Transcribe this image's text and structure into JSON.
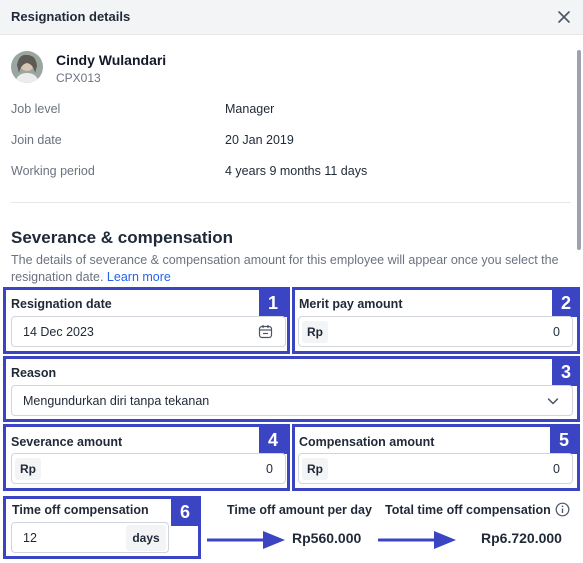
{
  "header": {
    "title": "Resignation details"
  },
  "employee": {
    "name": "Cindy Wulandari",
    "code": "CPX013"
  },
  "info": [
    {
      "label": "Job level",
      "value": "Manager"
    },
    {
      "label": "Join date",
      "value": "20 Jan 2019"
    },
    {
      "label": "Working period",
      "value": "4 years 9 months 11 days"
    }
  ],
  "section": {
    "title": "Severance & compensation",
    "description": "The details of severance & compensation amount for this employee will appear once you select the resignation date.",
    "learn_more": "Learn more"
  },
  "annotations": [
    "1",
    "2",
    "3",
    "4",
    "5",
    "6"
  ],
  "fields": {
    "resignation_date": {
      "label": "Resignation date",
      "value": "14 Dec 2023"
    },
    "merit_pay": {
      "label": "Merit pay amount",
      "prefix": "Rp",
      "value": "0"
    },
    "reason": {
      "label": "Reason",
      "value": "Mengundurkan diri tanpa tekanan"
    },
    "severance": {
      "label": "Severance amount",
      "prefix": "Rp",
      "value": "0"
    },
    "compensation": {
      "label": "Compensation amount",
      "prefix": "Rp",
      "value": "0"
    },
    "time_off": {
      "label": "Time off compensation",
      "value": "12",
      "suffix": "days"
    }
  },
  "calc": {
    "per_day_label": "Time off amount per day",
    "per_day_value": "Rp560.000",
    "total_label": "Total time off compensation",
    "total_value": "Rp6.720.000"
  },
  "colors": {
    "annotation": "#3b45c4",
    "link": "#2563eb"
  }
}
